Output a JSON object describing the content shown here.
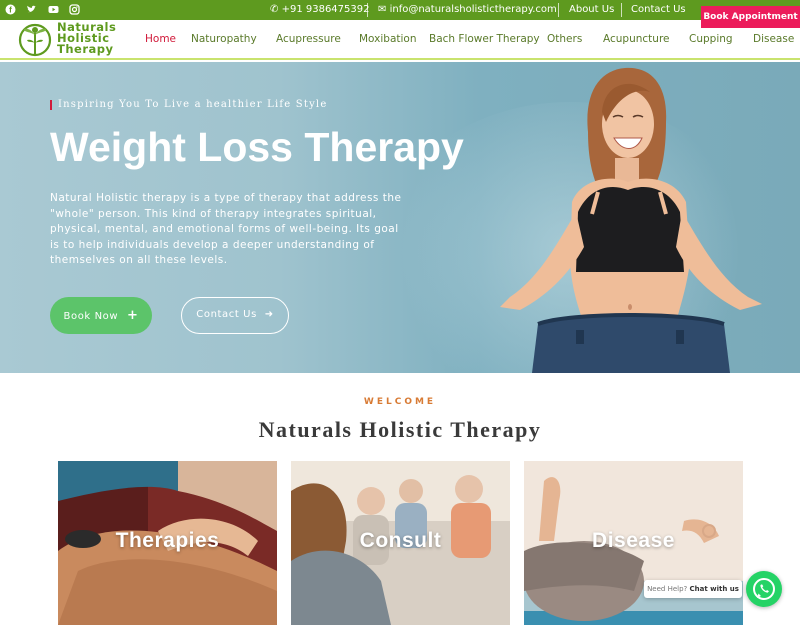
{
  "topbar": {
    "phone": "+91 9386475392",
    "email": "info@naturalsholistictherapy.com",
    "about": "About Us",
    "contact": "Contact Us",
    "book_appointment": "Book Appointment",
    "social_icons": [
      "facebook-icon",
      "twitter-icon",
      "youtube-icon",
      "instagram-icon"
    ]
  },
  "logo": {
    "line1": "Naturals",
    "line2": "Holistic",
    "line3": "Therapy"
  },
  "nav": {
    "items": [
      "Home",
      "Naturopathy",
      "Acupressure",
      "Moxibation",
      "Bach Flower Therapy",
      "Others",
      "Acupuncture",
      "Cupping",
      "Disease"
    ],
    "active": "Home"
  },
  "hero": {
    "tagline": "Inspiring You To Live a healthier Life Style",
    "title": "Weight Loss Therapy",
    "description": "Natural Holistic therapy is a type of therapy that address the \"whole\" person. This kind of therapy integrates spiritual, physical, mental, and emotional forms of well-being. Its goal is to help individuals develop a deeper understanding of themselves on all these levels.",
    "book_now": "Book Now",
    "contact_us": "Contact Us"
  },
  "welcome": {
    "eyebrow": "WELCOME",
    "title": "Naturals Holistic Therapy"
  },
  "cards": [
    {
      "label": "Therapies"
    },
    {
      "label": "Consult"
    },
    {
      "label": "Disease"
    }
  ],
  "chat": {
    "prefix": "Need Help?",
    "action": "Chat with us"
  },
  "colors": {
    "brand_green": "#5e9a1f",
    "accent_pink": "#ec1c5b",
    "button_green": "#5cc46a",
    "whatsapp": "#25d366",
    "welcome_orange": "#d87b35"
  }
}
